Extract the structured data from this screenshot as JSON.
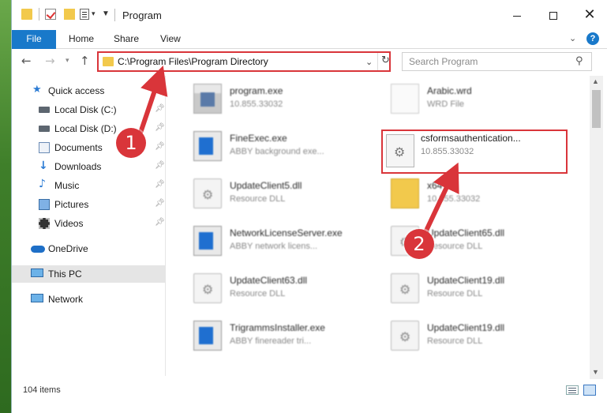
{
  "window": {
    "title": "Program",
    "minimize_icon": "minimize-icon",
    "maximize_icon": "maximize-icon",
    "close_icon": "close-icon"
  },
  "ribbon": {
    "tabs": [
      {
        "label": "File"
      },
      {
        "label": "Home"
      },
      {
        "label": "Share"
      },
      {
        "label": "View"
      }
    ],
    "accent_color": "#1979ca",
    "help_label": "?"
  },
  "navigation": {
    "address": "C:\\Program Files\\Program Directory",
    "search_placeholder": "Search Program"
  },
  "sidebar": {
    "items": [
      {
        "label": "Quick access",
        "icon": "star-icon",
        "pinned": false
      },
      {
        "label": "Local Disk (C:)",
        "icon": "disk-icon",
        "pinned": true
      },
      {
        "label": "Local Disk (D:)",
        "icon": "disk-icon",
        "pinned": true
      },
      {
        "label": "Documents",
        "icon": "documents-icon",
        "pinned": true
      },
      {
        "label": "Downloads",
        "icon": "download-icon",
        "pinned": true
      },
      {
        "label": "Music",
        "icon": "music-icon",
        "pinned": true
      },
      {
        "label": "Pictures",
        "icon": "pictures-icon",
        "pinned": true
      },
      {
        "label": "Videos",
        "icon": "videos-icon",
        "pinned": true
      },
      {
        "label": "OneDrive",
        "icon": "cloud-icon",
        "pinned": false
      },
      {
        "label": "This PC",
        "icon": "computer-icon",
        "pinned": false,
        "selected": true
      },
      {
        "label": "Network",
        "icon": "network-icon",
        "pinned": false
      }
    ]
  },
  "files": [
    {
      "name": "program.exe",
      "meta": "10.855.33032",
      "icon": "exe-icon"
    },
    {
      "name": "Arabic.wrd",
      "meta": "WRD File",
      "icon": "wrd-file-icon"
    },
    {
      "name": "FineExec.exe",
      "meta": "ABBY background exe...",
      "icon": "app-icon"
    },
    {
      "name": "csformsauthentication...",
      "meta": "10.855.33032",
      "icon": "dll-icon",
      "highlighted": true
    },
    {
      "name": "UpdateClient5.dll",
      "meta": "Resource DLL",
      "icon": "dll-icon"
    },
    {
      "name": "x64",
      "meta": "10.855.33032",
      "icon": "folder-icon"
    },
    {
      "name": "NetworkLicenseServer.exe",
      "meta": "ABBY network licens...",
      "icon": "app-icon"
    },
    {
      "name": "UpdateClient65.dll",
      "meta": "Resource DLL",
      "icon": "dll-icon"
    },
    {
      "name": "UpdateClient63.dll",
      "meta": "Resource DLL",
      "icon": "dll-icon"
    },
    {
      "name": "UpdateClient19.dll",
      "meta": "Resource DLL",
      "icon": "dll-icon"
    },
    {
      "name": "TrigrammsInstaller.exe",
      "meta": "ABBY finereader tri...",
      "icon": "app-icon"
    },
    {
      "name": "UpdateClient19.dll",
      "meta": "Resource DLL",
      "icon": "dll-icon"
    }
  ],
  "status": {
    "item_count": "104 items"
  },
  "annotations": {
    "step1": "1",
    "step2": "2",
    "highlight_color": "#d9353a"
  }
}
